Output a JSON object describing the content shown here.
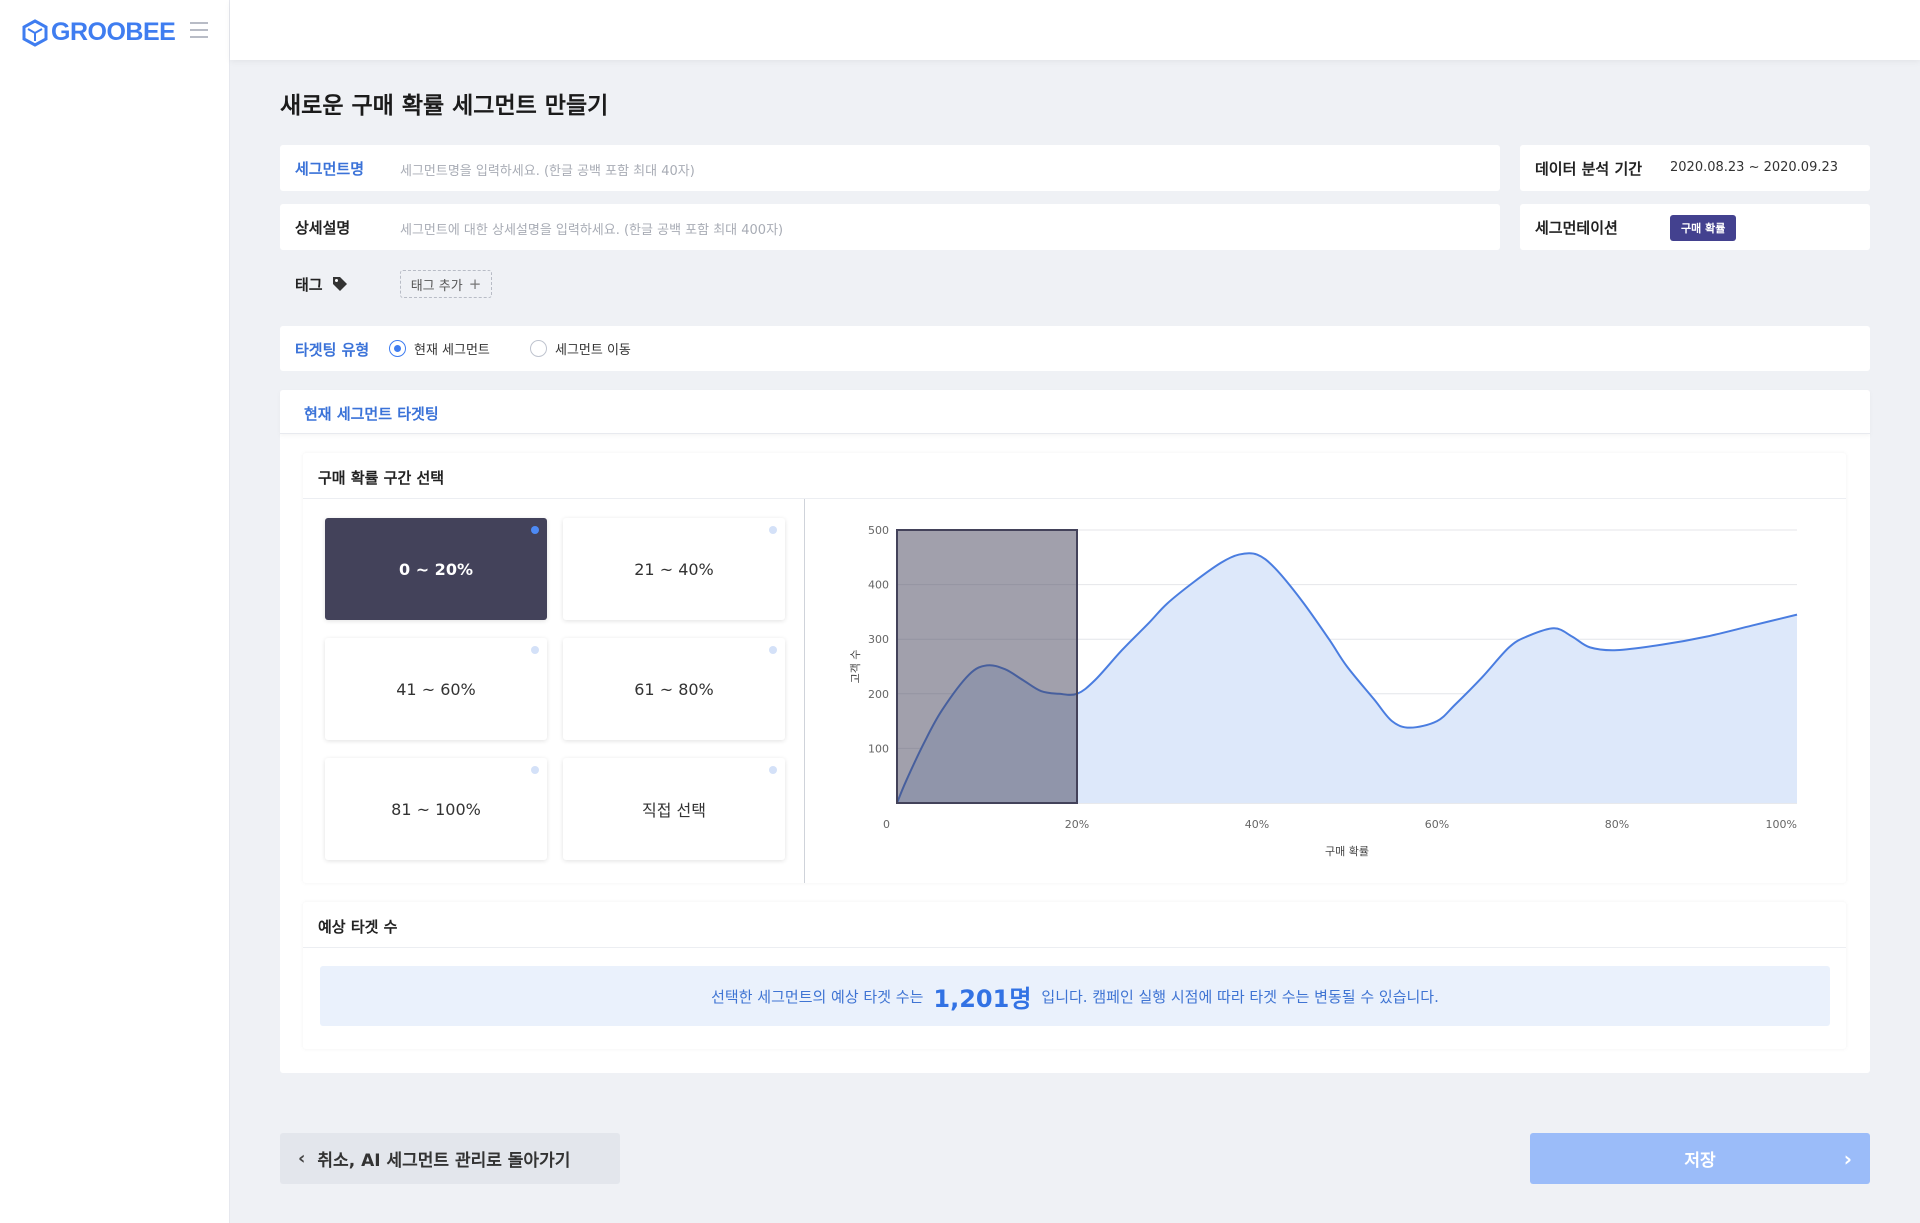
{
  "brand": {
    "name": "GROOBEE",
    "color": "#3f7df0"
  },
  "page": {
    "title": "새로운 구매 확률 세그먼트 만들기"
  },
  "form": {
    "segment_name_label": "세그먼트명",
    "segment_name_placeholder": "세그먼트명을 입력하세요. (한글 공백 포함 최대 40자)",
    "detail_label": "상세설명",
    "detail_placeholder": "세그먼트에 대한 상세설명을 입력하세요. (한글 공백 포함 최대 400자)",
    "tag_label": "태그",
    "tag_add": "태그 추가",
    "period_label": "데이터 분석 기간",
    "period_value": "2020.08.23 ~ 2020.09.23",
    "segmentation_label": "세그먼테이션",
    "segmentation_badge": "구매 확률"
  },
  "targeting": {
    "label": "타겟팅 유형",
    "options": [
      {
        "label": "현재 세그먼트",
        "selected": true
      },
      {
        "label": "세그먼트 이동",
        "selected": false
      }
    ],
    "panel_title": "현재 세그먼트 타겟팅"
  },
  "range_select": {
    "title": "구매 확률 구간 선택",
    "buttons": [
      {
        "label": "0 ~ 20%",
        "active": true
      },
      {
        "label": "21 ~ 40%",
        "active": false
      },
      {
        "label": "41 ~ 60%",
        "active": false
      },
      {
        "label": "61 ~ 80%",
        "active": false
      },
      {
        "label": "81 ~ 100%",
        "active": false
      },
      {
        "label": "직접 선택",
        "active": false
      }
    ]
  },
  "chart_data": {
    "type": "area",
    "xlabel": "구매 확률",
    "ylabel": "고객 수",
    "x_ticks": [
      "0",
      "20%",
      "40%",
      "60%",
      "80%",
      "100%"
    ],
    "y_ticks": [
      "100",
      "200",
      "300",
      "400",
      "500"
    ],
    "ylim": [
      0,
      500
    ],
    "xlim": [
      0,
      100
    ],
    "grid": true,
    "selected_range": [
      0,
      20
    ],
    "x": [
      0,
      1,
      3,
      5,
      8,
      10,
      12,
      14,
      16,
      18,
      20,
      22,
      25,
      28,
      30,
      33,
      36,
      38,
      40,
      42,
      45,
      48,
      50,
      53,
      55,
      57,
      60,
      62,
      65,
      68,
      70,
      73,
      75,
      77,
      80,
      85,
      90,
      95,
      100
    ],
    "y": [
      0,
      40,
      110,
      170,
      235,
      252,
      245,
      225,
      205,
      200,
      200,
      225,
      280,
      330,
      365,
      405,
      440,
      455,
      455,
      430,
      370,
      300,
      250,
      190,
      150,
      138,
      150,
      180,
      230,
      285,
      305,
      320,
      305,
      285,
      280,
      290,
      305,
      325,
      345
    ],
    "series_color": "#4a7de0",
    "fill_color": "#dde8fa",
    "selection_color": "#43425a"
  },
  "estimate": {
    "title": "예상 타겟 수",
    "prefix": "선택한 세그먼트의 예상 타겟 수는",
    "count": "1,201명",
    "suffix": "입니다. 캠페인 실행 시점에 따라 타겟 수는 변동될 수 있습니다."
  },
  "actions": {
    "cancel_label": "취소, AI 세그먼트 관리로 돌아가기",
    "save_label": "저장"
  }
}
